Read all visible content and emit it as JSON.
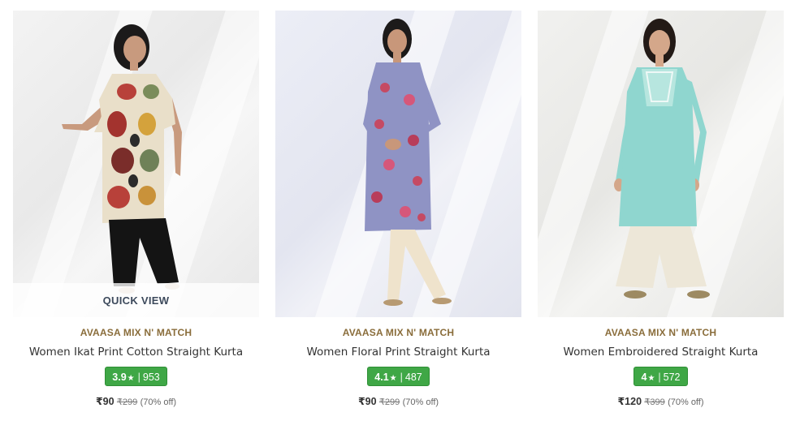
{
  "products": [
    {
      "brand": "AVAASA MIX N' MATCH",
      "name": "Women Ikat Print Cotton Straight Kurta",
      "rating": "3.9",
      "star": "★",
      "reviews": "953",
      "price": "₹90",
      "mrp": "₹299",
      "discount": "(70% off)",
      "quick_view": "QUICK VIEW"
    },
    {
      "brand": "AVAASA MIX N' MATCH",
      "name": "Women Floral Print Straight Kurta",
      "rating": "4.1",
      "star": "★",
      "reviews": "487",
      "price": "₹90",
      "mrp": "₹299",
      "discount": "(70% off)"
    },
    {
      "brand": "AVAASA MIX N' MATCH",
      "name": "Women Embroidered Straight Kurta",
      "rating": "4",
      "star": "★",
      "reviews": "572",
      "price": "₹120",
      "mrp": "₹399",
      "discount": "(70% off)"
    }
  ],
  "colors": {
    "brand_text": "#8a6d3b",
    "rating_bg": "#3fa746",
    "kurta_1": "#e9dfc9",
    "kurta_2": "#8f93c4",
    "kurta_3": "#8fd6cf"
  }
}
